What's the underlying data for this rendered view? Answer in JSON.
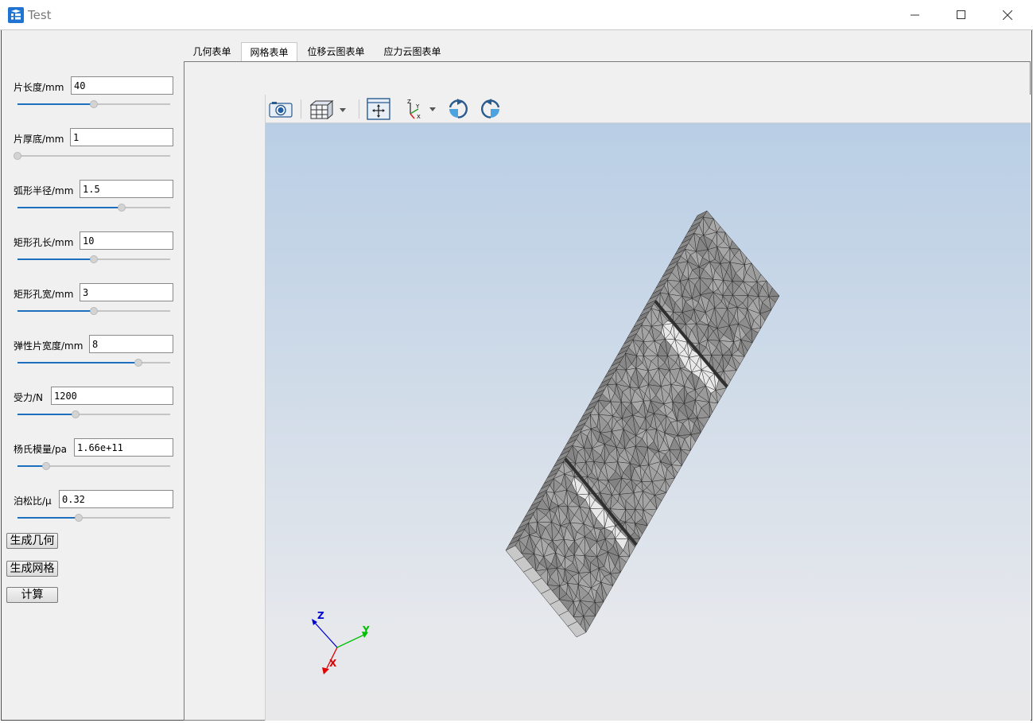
{
  "window": {
    "title": "Test",
    "controls": [
      "minimize-icon",
      "maximize-icon",
      "close-icon"
    ]
  },
  "params": [
    {
      "label": "片长度/mm",
      "value": "40",
      "slider": 0.5
    },
    {
      "label": "片厚底/mm",
      "value": "1",
      "slider": 0.0
    },
    {
      "label": "弧形半径/mm",
      "value": "1.5",
      "slider": 0.68
    },
    {
      "label": "矩形孔长/mm",
      "value": "10",
      "slider": 0.5
    },
    {
      "label": "矩形孔宽/mm",
      "value": "3",
      "slider": 0.5
    },
    {
      "label": "弹性片宽度/mm",
      "value": "8",
      "slider": 0.79
    },
    {
      "label": "受力/N",
      "value": "1200",
      "slider": 0.38
    },
    {
      "label": "杨氏模量/pa",
      "value": "1.66e+11",
      "slider": 0.19
    },
    {
      "label": "泊松比/μ",
      "value": "0.32",
      "slider": 0.4
    }
  ],
  "actions": {
    "gen_geometry": "生成几何",
    "gen_mesh": "生成网格",
    "compute": "计算"
  },
  "tabs": [
    "几何表单",
    "网格表单",
    "位移云图表单",
    "应力云图表单"
  ],
  "active_tab": "网格表单",
  "toolbar": {
    "buttons": [
      "camera-icon",
      "view-cube-icon",
      "fit-all-icon",
      "axes-icon",
      "rotate-cw-icon",
      "rotate-ccw-icon"
    ]
  },
  "axes": {
    "x": "X",
    "y": "Y",
    "z": "Z"
  },
  "colors": {
    "accent": "#1f6fbf",
    "mesh_face": "#a6a6a6",
    "mesh_line": "#2b2b2b",
    "axis_x": "#e00000",
    "axis_y": "#00c000",
    "axis_z": "#0000d0"
  }
}
